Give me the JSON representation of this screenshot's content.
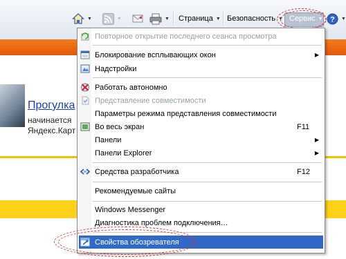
{
  "toolbar": {
    "page_label": "Страница",
    "safety_label": "Безопасность",
    "tools_label": "Сервис"
  },
  "page": {
    "link_text": "Прогулка",
    "line1": "начинается",
    "line2": "Яндекс.Карт"
  },
  "menu": {
    "items": [
      {
        "label": "Повторное открытие последнего сеанса просмотра",
        "disabled": true,
        "icon": "reopen-session-icon"
      },
      {
        "label": "Блокирование всплывающих окон",
        "submenu": true,
        "icon": "popup-blocker-icon"
      },
      {
        "label": "Надстройки",
        "icon": "addons-icon"
      },
      {
        "label": "Работать автономно",
        "icon": "work-offline-icon"
      },
      {
        "label": "Представление совместимости",
        "disabled": true,
        "icon": "compatibility-view-icon"
      },
      {
        "label": "Параметры режима представления совместимости"
      },
      {
        "label": "Во весь экран",
        "shortcut": "F11",
        "icon": "full-screen-icon"
      },
      {
        "label": "Панели",
        "submenu": true
      },
      {
        "label": "Панели Explorer",
        "submenu": true
      },
      {
        "label": "Средства разработчика",
        "shortcut": "F12",
        "icon": "developer-tools-icon"
      },
      {
        "label": "Рекомендуемые сайты"
      },
      {
        "label": "Windows Messenger"
      },
      {
        "label": "Диагностика проблем подключения…"
      },
      {
        "label": "Свойства обозревателя",
        "selected": true,
        "icon": "internet-options-icon"
      }
    ]
  },
  "colors": {
    "selection": "#3169c6",
    "highlight_ellipse": "#d23a3a",
    "brand_orange": "#f47b1c",
    "brand_yellow": "#ffd21a"
  }
}
